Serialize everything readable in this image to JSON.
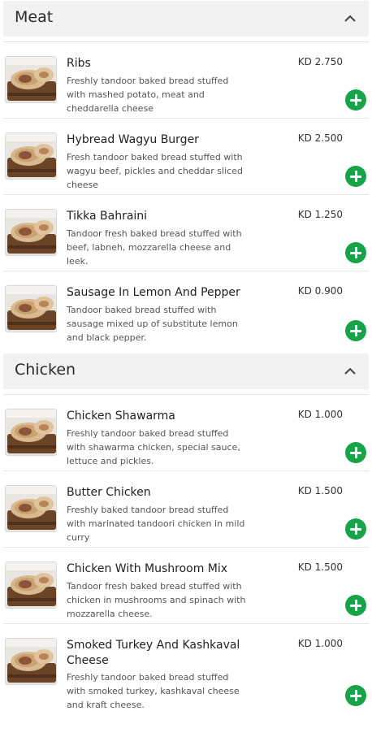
{
  "sections": [
    {
      "title": "Meat",
      "items": [
        {
          "name": "Ribs",
          "desc": "Freshly tandoor baked bread stuffed with mashed potato, meat and cheddarella cheese",
          "price": "KD 2.750"
        },
        {
          "name": "Hybread Wagyu Burger",
          "desc": "Fresh tandoor baked bread stuffed with wagyu beef, pickles and cheddar sliced cheese",
          "price": "KD 2.500"
        },
        {
          "name": "Tikka Bahraini",
          "desc": "Tandoor fresh baked bread stuffed with beef, labneh, mozzarella cheese and leek.",
          "price": "KD 1.250"
        },
        {
          "name": "Sausage In Lemon And Pepper",
          "desc": "Tandoor baked bread stuffed with sausage mixed up of substitute lemon and black pepper.",
          "price": "KD 0.900"
        }
      ]
    },
    {
      "title": "Chicken",
      "items": [
        {
          "name": "Chicken Shawarma",
          "desc": "Freshly tandoor baked bread stuffed with shawarma chicken, special sauce, lettuce and pickles.",
          "price": "KD 1.000"
        },
        {
          "name": "Butter Chicken",
          "desc": "Freshly baked tandoor bread stuffed with marinated tandoori chicken in mild curry",
          "price": "KD 1.500"
        },
        {
          "name": "Chicken With Mushroom Mix",
          "desc": "Tandoor fresh baked bread stuffed with chicken in mushrooms and spinach with mozzarella cheese.",
          "price": "KD 1.500"
        },
        {
          "name": "Smoked Turkey And Kashkaval Cheese",
          "desc": "Freshly tandoor baked bread stuffed with smoked turkey, kashkaval cheese and kraft cheese.",
          "price": "KD 1.000"
        }
      ]
    }
  ],
  "icons": {
    "collapse": "chevron-up-icon",
    "add": "plus-circle-icon",
    "dish": "food-photo"
  },
  "colors": {
    "accent": "#17a348",
    "header_bg": "#f2f2f2"
  }
}
